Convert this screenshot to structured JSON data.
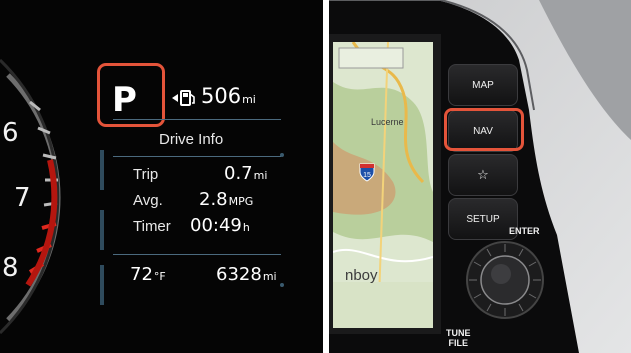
{
  "cluster": {
    "gauge_numbers": [
      "6",
      "7",
      "8"
    ],
    "gear": "P",
    "range": {
      "value": "506",
      "unit": "mi"
    },
    "panel_title": "Drive Info",
    "rows": [
      {
        "label": "Trip",
        "value": "0.7",
        "unit": "mi"
      },
      {
        "label": "Avg.",
        "value": "2.8",
        "unit": "MPG"
      },
      {
        "label": "Timer",
        "value": "00:49",
        "unit": "h"
      }
    ],
    "temperature": {
      "value": "72",
      "unit": "°F"
    },
    "odometer": {
      "value": "6328",
      "unit": "mi"
    },
    "icons": {
      "fuel": "fuel-pump-icon"
    },
    "highlight_color": "#e4543a"
  },
  "headunit": {
    "buttons": [
      {
        "name": "map-button",
        "label": "MAP"
      },
      {
        "name": "nav-button",
        "label": "NAV"
      },
      {
        "name": "favorite-button",
        "label": "☆"
      },
      {
        "name": "setup-button",
        "label": "SETUP"
      }
    ],
    "enter_label": "ENTER",
    "tune_label_line1": "TUNE",
    "tune_label_line2": "FILE",
    "map": {
      "place_label": "nboy",
      "top_label": "Lucerne",
      "highway": "15"
    },
    "highlight_color": "#e4543a"
  }
}
